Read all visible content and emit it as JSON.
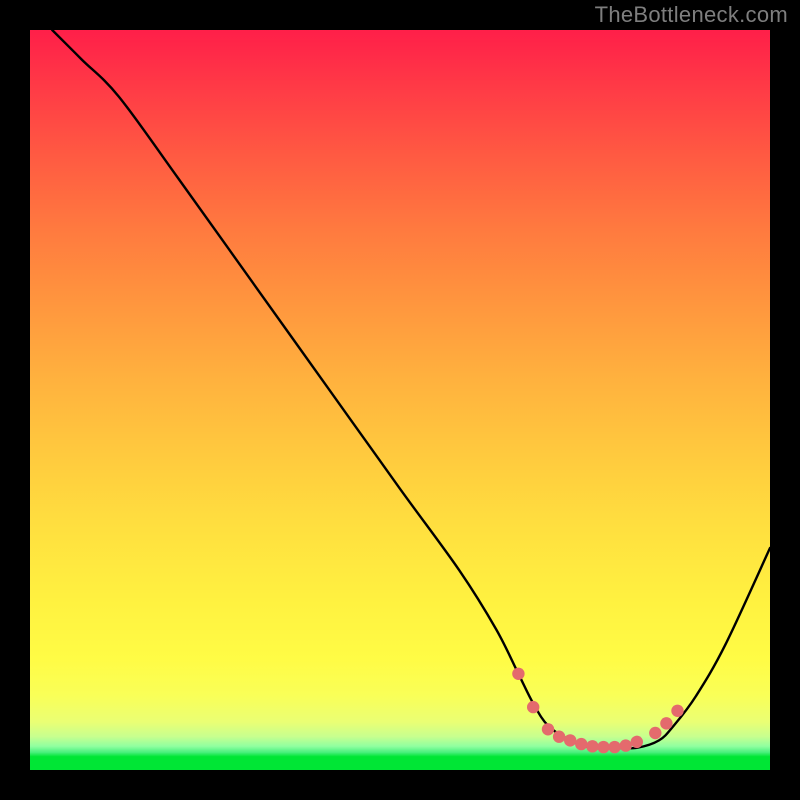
{
  "attribution": "TheBottleneck.com",
  "colors": {
    "page_bg": "#000000",
    "attribution_text": "#7e7e7e",
    "curve_stroke": "#000000",
    "marker_fill": "#e46a6d",
    "bottom_strip": "#00e635",
    "gradient_top": "#ff1f49",
    "gradient_bottom": "#00e635"
  },
  "chart_data": {
    "type": "line",
    "title": "",
    "xlabel": "",
    "ylabel": "",
    "xlim": [
      0,
      100
    ],
    "ylim": [
      0,
      100
    ],
    "grid": false,
    "legend": false,
    "series": [
      {
        "name": "bottleneck-curve",
        "x": [
          3,
          7,
          12,
          20,
          30,
          40,
          50,
          58,
          63,
          66,
          68,
          70,
          73,
          76,
          79,
          82,
          85,
          87,
          90,
          94,
          100
        ],
        "y": [
          100,
          96,
          91,
          80,
          66,
          52,
          38,
          27,
          19,
          13,
          9,
          6,
          4,
          3,
          3,
          3,
          4,
          6,
          10,
          17,
          30
        ]
      }
    ],
    "markers": {
      "name": "valley-markers",
      "x": [
        66,
        68,
        70,
        71.5,
        73,
        74.5,
        76,
        77.5,
        79,
        80.5,
        82,
        84.5,
        86,
        87.5
      ],
      "y": [
        13,
        8.5,
        5.5,
        4.5,
        4,
        3.5,
        3.2,
        3.1,
        3.1,
        3.3,
        3.8,
        5,
        6.3,
        8
      ]
    },
    "notes": "No axes, ticks, or labels are rendered in the image. Values are read off approximately, mapping the visible plot interior to a 0–100 scale on both axes (0 at bottom-left). The curve descends from top-left, flattens in a valley near x≈70–85, then rises toward the right edge. Salmon-colored round markers sit along the valley floor."
  }
}
